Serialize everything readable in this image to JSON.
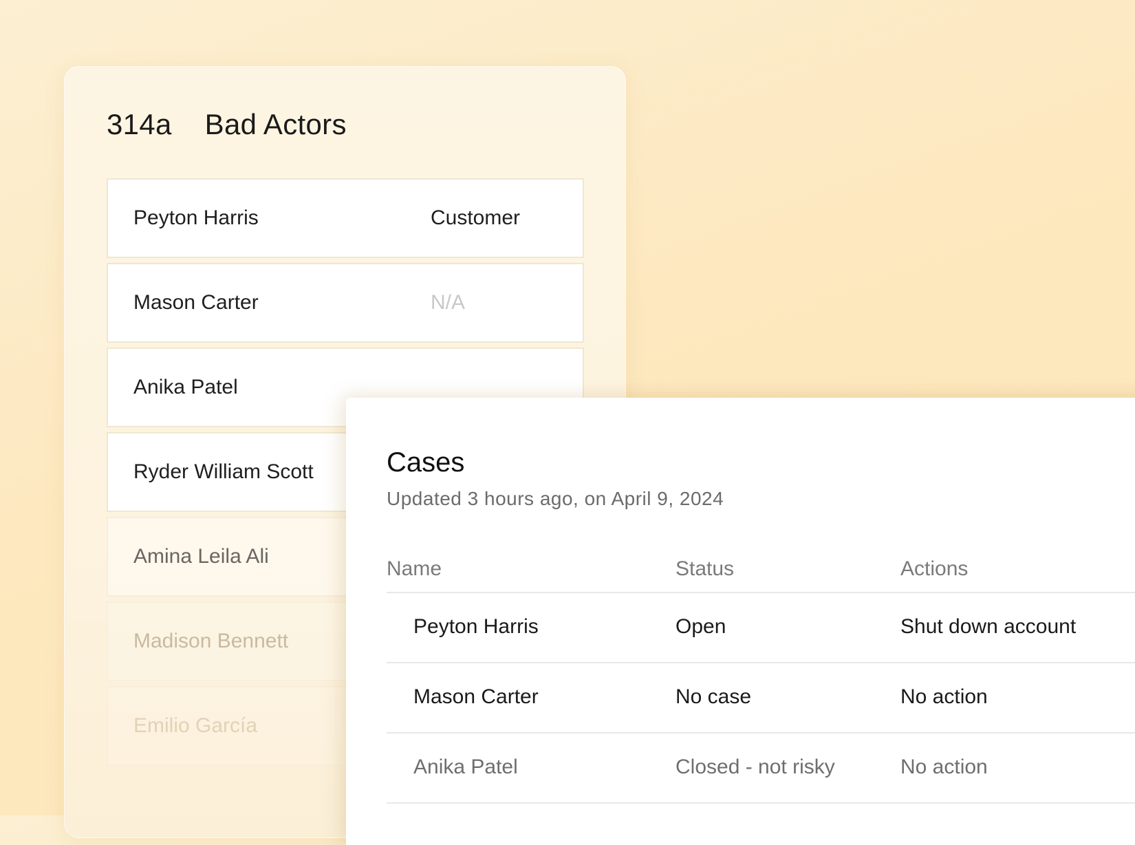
{
  "actors_card": {
    "code": "314a",
    "title": "Bad Actors",
    "rows": [
      {
        "name": "Peyton Harris",
        "role": "Customer"
      },
      {
        "name": "Mason Carter",
        "role": "N/A"
      },
      {
        "name": "Anika Patel",
        "role": ""
      },
      {
        "name": "Ryder William Scott",
        "role": ""
      },
      {
        "name": "Amina Leila Ali",
        "role": ""
      },
      {
        "name": "Madison Bennett",
        "role": ""
      },
      {
        "name": "Emilio García",
        "role": ""
      }
    ]
  },
  "cases_card": {
    "title": "Cases",
    "subtitle": "Updated 3 hours ago, on April 9, 2024",
    "columns": {
      "name": "Name",
      "status": "Status",
      "actions": "Actions"
    },
    "rows": [
      {
        "name": "Peyton Harris",
        "status": "Open",
        "action": "Shut down account"
      },
      {
        "name": "Mason Carter",
        "status": "No case",
        "action": "No action"
      },
      {
        "name": "Anika Patel",
        "status": "Closed - not risky",
        "action": "No action"
      }
    ]
  }
}
